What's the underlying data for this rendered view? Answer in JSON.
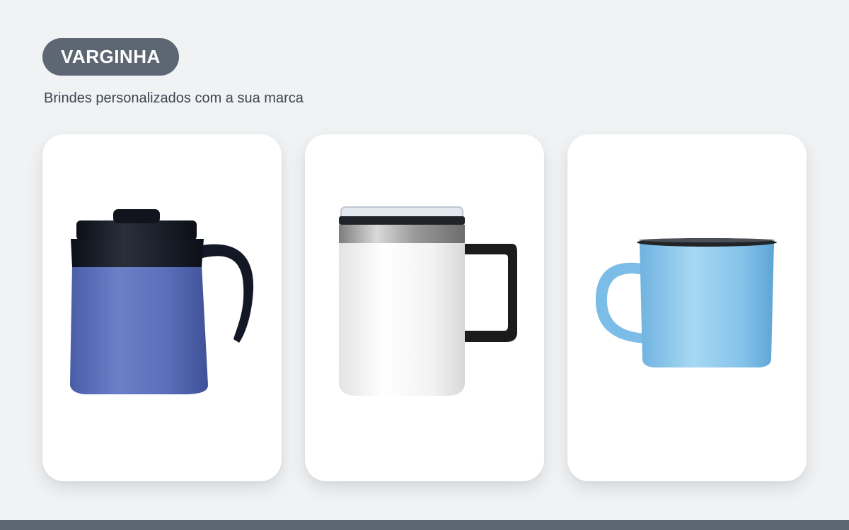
{
  "header": {
    "badge_label": "VARGINHA",
    "subtitle": "Brindes personalizados com a sua marca"
  },
  "products": [
    {
      "image": "blue-thermal-mug-with-black-lid",
      "body_color": "#5b6fb5"
    },
    {
      "image": "white-steel-mug-with-clear-lid",
      "body_color": "#f4f4f4"
    },
    {
      "image": "light-blue-enamel-mug",
      "body_color": "#8ec8ea"
    }
  ],
  "colors": {
    "background": "#f0f2f4",
    "accent": "#5d6673",
    "text": "#3c4653"
  }
}
